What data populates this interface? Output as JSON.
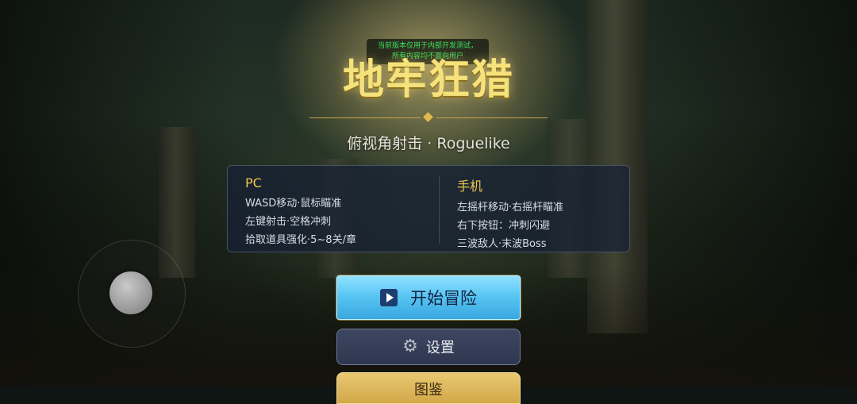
{
  "notice": {
    "line1": "当前版本仅用于内部开发测试，",
    "line2": "所有内容均不面向用户"
  },
  "title": "地牢狂猎",
  "subtitle": "俯视角射击 · Roguelike",
  "controls": {
    "pc": {
      "heading": "PC",
      "lines": [
        "WASD移动·鼠标瞄准",
        "左键射击·空格冲刺",
        "拾取道具强化·5~8关/章"
      ]
    },
    "mobile": {
      "heading": "手机",
      "lines": [
        "左摇杆移动·右摇杆瞄准",
        "右下按钮：冲刺闪避",
        "三波敌人·末波Boss"
      ]
    }
  },
  "buttons": {
    "start": "开始冒险",
    "settings": "设置",
    "third": "图鉴"
  },
  "icons": {
    "start": "play-icon",
    "settings": "gear-icon"
  },
  "colors": {
    "title": "#f6e27a",
    "accent_gold": "#f1c54e",
    "start_button": "#55c3f2",
    "notice_text": "#3fe05a"
  }
}
